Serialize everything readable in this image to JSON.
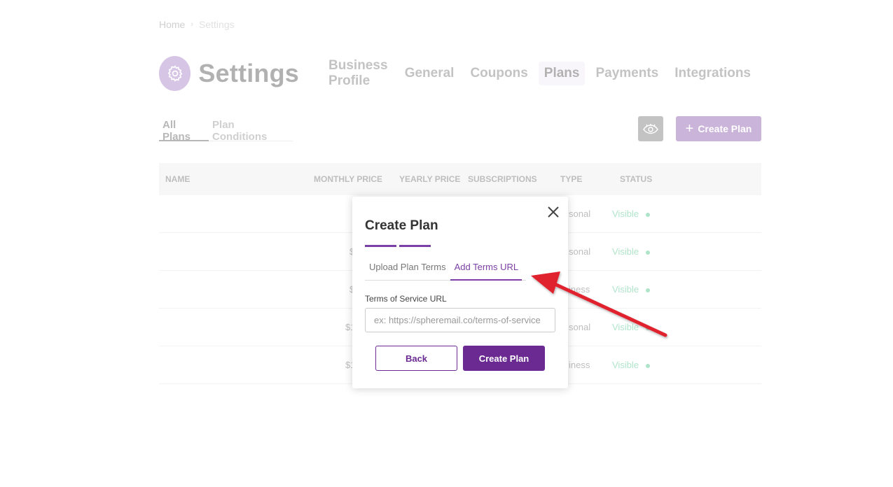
{
  "breadcrumb": {
    "home": "Home",
    "current": "Settings"
  },
  "header": {
    "title": "Settings",
    "tabs": [
      "Business Profile",
      "General",
      "Coupons",
      "Plans",
      "Payments",
      "Integrations"
    ],
    "active_tab": "Plans"
  },
  "sub_tabs": [
    "All Plans",
    "Plan Conditions"
  ],
  "toolbar": {
    "create_plan_label": "Create Plan"
  },
  "table": {
    "headers": [
      "NAME",
      "MONTHLY PRICE",
      "YEARLY PRICE",
      "SUBSCRIPTIONS",
      "TYPE",
      "STATUS"
    ],
    "rows": [
      {
        "price_partial": "",
        "type_partial": "sonal",
        "status": "Visible"
      },
      {
        "price_partial": "$",
        "type_partial": "sonal",
        "status": "Visible"
      },
      {
        "price_partial": "$",
        "type_partial": "iness",
        "status": "Visible"
      },
      {
        "price_partial": "$1",
        "type_partial": "sonal",
        "status": "Visible"
      },
      {
        "price_partial": "$1",
        "type_partial": "iness",
        "status": "Visible"
      }
    ]
  },
  "modal": {
    "title": "Create Plan",
    "tabs": [
      "Upload Plan Terms",
      "Add Terms URL"
    ],
    "active_tab": "Add Terms URL",
    "field_label": "Terms of Service URL",
    "input_placeholder": "ex: https://spheremail.co/terms-of-service",
    "input_value": "",
    "back_label": "Back",
    "submit_label": "Create Plan"
  },
  "colors": {
    "accent": "#6b2a92",
    "status_green": "#1bb36a",
    "annotation_arrow": "#e0202e"
  }
}
